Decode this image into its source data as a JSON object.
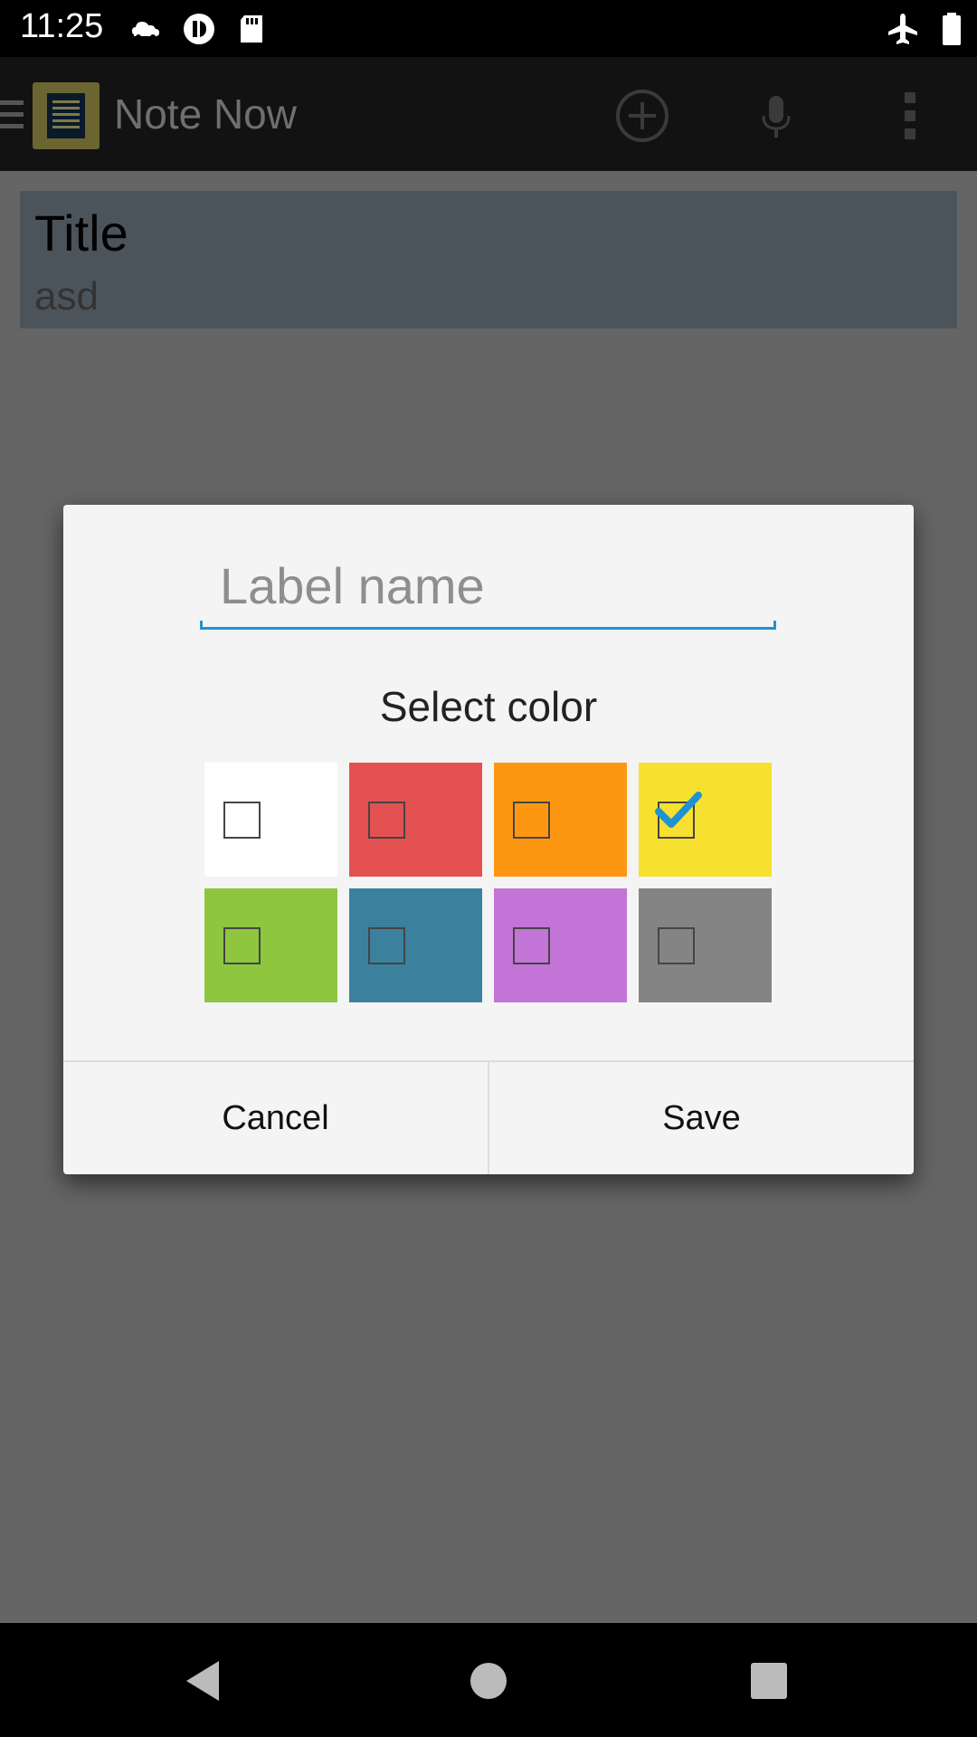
{
  "status_bar": {
    "time": "11:25",
    "icons": [
      "cloud-car-icon",
      "app-notification-icon",
      "sd-card-icon",
      "airplane-mode-icon",
      "battery-icon"
    ]
  },
  "app_bar": {
    "title": "Note Now",
    "icons": [
      "menu-icon",
      "app-logo-icon",
      "add-circle-icon",
      "microphone-icon",
      "more-vert-icon"
    ]
  },
  "note": {
    "title": "Title",
    "body": "asd"
  },
  "dialog": {
    "label_placeholder": "Label name",
    "label_value": "",
    "select_color_label": "Select color",
    "colors": [
      {
        "name": "white",
        "hex": "#ffffff",
        "checked": false
      },
      {
        "name": "red",
        "hex": "#e35151",
        "checked": false
      },
      {
        "name": "orange",
        "hex": "#fd9712",
        "checked": false
      },
      {
        "name": "yellow",
        "hex": "#f8e030",
        "checked": true
      },
      {
        "name": "green",
        "hex": "#8ec63f",
        "checked": false
      },
      {
        "name": "teal",
        "hex": "#3b819e",
        "checked": false
      },
      {
        "name": "purple",
        "hex": "#c275d7",
        "checked": false
      },
      {
        "name": "gray",
        "hex": "#848484",
        "checked": false
      }
    ],
    "cancel_label": "Cancel",
    "save_label": "Save",
    "accent": "#1e93d3"
  },
  "nav_bar": {
    "icons": [
      "back-icon",
      "home-icon",
      "recents-icon"
    ]
  }
}
